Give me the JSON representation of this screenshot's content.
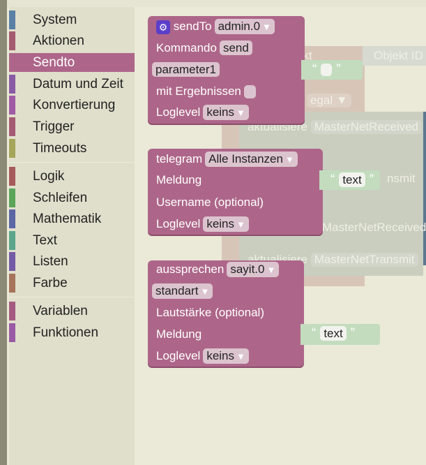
{
  "toolbox": [
    {
      "label": "System",
      "color": "#5b80a5"
    },
    {
      "label": "Aktionen",
      "color": "#a55b6f"
    },
    {
      "label": "Sendto",
      "color": "#ad6689",
      "selected": true
    },
    {
      "label": "Datum und Zeit",
      "color": "#8a5ba5"
    },
    {
      "label": "Konvertierung",
      "color": "#a05ba5"
    },
    {
      "label": "Trigger",
      "color": "#a55b74"
    },
    {
      "label": "Timeouts",
      "color": "#a5a55b"
    },
    {
      "label": "Logik",
      "color": "#a55b5b"
    },
    {
      "label": "Schleifen",
      "color": "#5ba55b"
    },
    {
      "label": "Mathematik",
      "color": "#5b67a5"
    },
    {
      "label": "Text",
      "color": "#5ba58c"
    },
    {
      "label": "Listen",
      "color": "#745ba5"
    },
    {
      "label": "Farbe",
      "color": "#a5745b"
    },
    {
      "label": "Variablen",
      "color": "#a55b80"
    },
    {
      "label": "Funktionen",
      "color": "#995ba5"
    }
  ],
  "sendto": {
    "title": "sendTo",
    "instance": "admin.0",
    "command_label": "Kommando",
    "command": "send",
    "param": "parameter1",
    "results_label": "mit Ergebnissen",
    "loglevel_label": "Loglevel",
    "loglevel": "keins"
  },
  "telegram": {
    "title": "telegram",
    "instance": "Alle Instanzen",
    "message_label": "Meldung",
    "message": "text",
    "username_label": "Username (optional)",
    "loglevel_label": "Loglevel",
    "loglevel": "keins"
  },
  "sayit": {
    "title": "aussprechen",
    "instance": "sayit.0",
    "lang": "standart",
    "volume_label": "Lautstärke (optional)",
    "message_label": "Meldung",
    "message": "text",
    "loglevel_label": "Loglevel",
    "loglevel": "keins"
  },
  "ghost": {
    "obj_id": "Objekt ID",
    "egal": "egal",
    "update1": "aktualisiere",
    "rx": "MasterNetReceived",
    "tx": "MasterNetTransmit",
    "frag_ekt": "ekt",
    "frag_smit": "nsmit"
  },
  "quotes": {
    "open": "“",
    "close": "”"
  }
}
